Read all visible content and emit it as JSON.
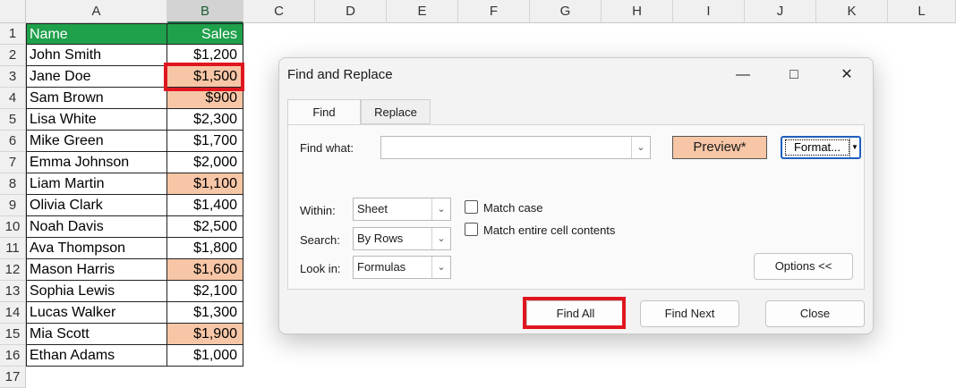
{
  "columns": [
    "A",
    "B",
    "C",
    "D",
    "E",
    "F",
    "G",
    "H",
    "I",
    "J",
    "K",
    "L"
  ],
  "rows": [
    "1",
    "2",
    "3",
    "4",
    "5",
    "6",
    "7",
    "8",
    "9",
    "10",
    "11",
    "12",
    "13",
    "14",
    "15",
    "16",
    "17"
  ],
  "table": {
    "header": {
      "name": "Name",
      "sales": "Sales"
    },
    "data": [
      {
        "name": "John Smith",
        "sales": "$1,200",
        "highlight": false
      },
      {
        "name": "Jane Doe",
        "sales": "$1,500",
        "highlight": true
      },
      {
        "name": "Sam Brown",
        "sales": "$900",
        "highlight": true
      },
      {
        "name": "Lisa White",
        "sales": "$2,300",
        "highlight": false
      },
      {
        "name": "Mike Green",
        "sales": "$1,700",
        "highlight": false
      },
      {
        "name": "Emma Johnson",
        "sales": "$2,000",
        "highlight": false
      },
      {
        "name": "Liam Martin",
        "sales": "$1,100",
        "highlight": true
      },
      {
        "name": "Olivia Clark",
        "sales": "$1,400",
        "highlight": false
      },
      {
        "name": "Noah Davis",
        "sales": "$2,500",
        "highlight": false
      },
      {
        "name": "Ava Thompson",
        "sales": "$1,800",
        "highlight": false
      },
      {
        "name": "Mason Harris",
        "sales": "$1,600",
        "highlight": true
      },
      {
        "name": "Sophia Lewis",
        "sales": "$2,100",
        "highlight": false
      },
      {
        "name": "Lucas Walker",
        "sales": "$1,300",
        "highlight": false
      },
      {
        "name": "Mia Scott",
        "sales": "$1,900",
        "highlight": true
      },
      {
        "name": "Ethan Adams",
        "sales": "$1,000",
        "highlight": false
      }
    ]
  },
  "colors": {
    "header_fill": "#1fa04b",
    "highlight_fill": "#f7c6a6",
    "callout": "#e0161f"
  },
  "dialog": {
    "title": "Find and Replace",
    "window_icons": {
      "minimize": "minimize-icon",
      "maximize": "maximize-icon",
      "close": "close-icon"
    },
    "tabs": [
      "Find",
      "Replace"
    ],
    "find_what_label": "Find what:",
    "find_what_value": "",
    "preview_label": "Preview*",
    "format_label": "Format...",
    "within_label": "Within:",
    "within_value": "Sheet",
    "search_label": "Search:",
    "search_value": "By Rows",
    "lookin_label": "Look in:",
    "lookin_value": "Formulas",
    "match_case_label": "Match case",
    "match_entire_label": "Match entire cell contents",
    "options_label": "Options <<",
    "find_all_label": "Find All",
    "find_next_label": "Find Next",
    "close_label": "Close"
  }
}
